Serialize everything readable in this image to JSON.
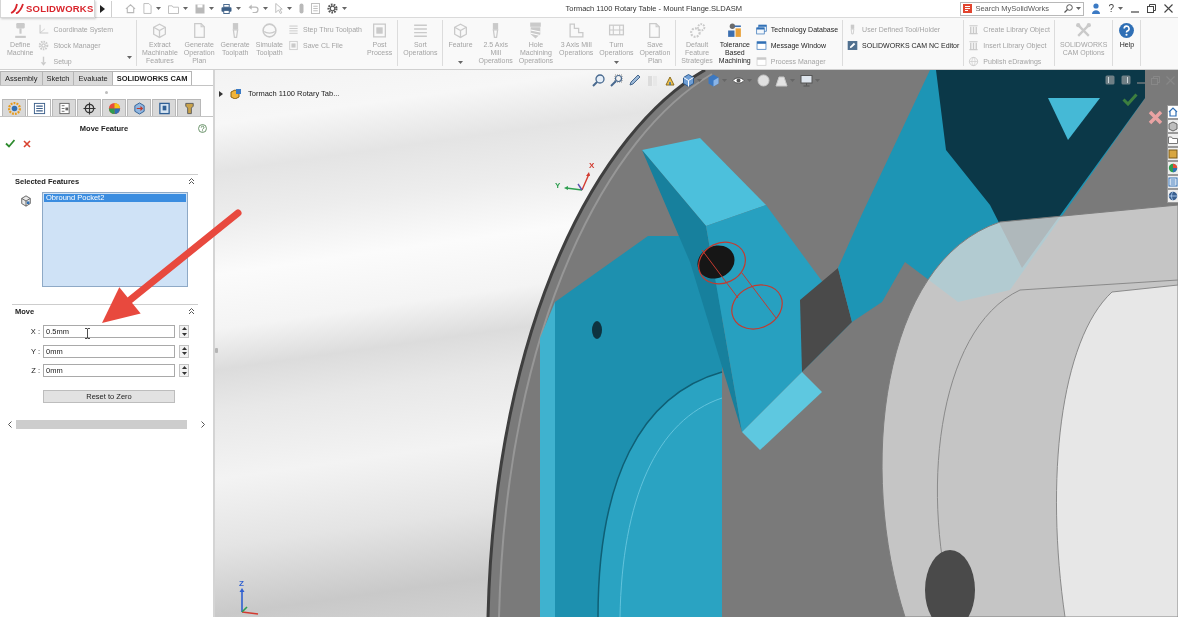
{
  "title_bar": {
    "logo": "SOLIDWORKS",
    "title": "Tormach 1100 Rotary Table - Mount Flange.SLDASM",
    "search": {
      "placeholder": "Search MySolidWorks"
    },
    "help_menu": "?"
  },
  "ribbon": {
    "groups": [
      {
        "items": [
          {
            "kind": "large",
            "label": "Define\nMachine",
            "disabled": true,
            "dropdown": false
          },
          {
            "kind": "stack",
            "dropdown": true,
            "entries": [
              {
                "label": "Coordinate System",
                "disabled": true
              },
              {
                "label": "Stock Manager",
                "disabled": true
              },
              {
                "label": "Setup",
                "disabled": true
              }
            ]
          }
        ]
      },
      {
        "items": [
          {
            "kind": "large",
            "label": "Extract\nMachinable\nFeatures",
            "disabled": true,
            "dropdown": false
          },
          {
            "kind": "large",
            "label": "Generate\nOperation\nPlan",
            "disabled": true,
            "dropdown": false
          },
          {
            "kind": "large",
            "label": "Generate\nToolpath",
            "disabled": true,
            "dropdown": false
          },
          {
            "kind": "large",
            "label": "Simulate\nToolpath",
            "disabled": true,
            "dropdown": false
          },
          {
            "kind": "stack",
            "dropdown": false,
            "entries": [
              {
                "label": "Step Thru Toolpath",
                "disabled": true
              },
              {
                "label": "Save CL File",
                "disabled": true
              }
            ]
          },
          {
            "kind": "large",
            "label": "Post\nProcess",
            "disabled": true,
            "dropdown": false
          }
        ]
      },
      {
        "items": [
          {
            "kind": "large",
            "label": "Sort\nOperations",
            "disabled": true,
            "dropdown": false
          }
        ]
      },
      {
        "items": [
          {
            "kind": "large",
            "label": "Feature",
            "disabled": true,
            "dropdown": true
          },
          {
            "kind": "large",
            "label": "2.5 Axis\nMill\nOperations",
            "disabled": true,
            "dropdown": false
          },
          {
            "kind": "large",
            "label": "Hole\nMachining\nOperations",
            "disabled": true,
            "dropdown": false
          },
          {
            "kind": "large",
            "label": "3 Axis Mill\nOperations",
            "disabled": true,
            "dropdown": false
          },
          {
            "kind": "large",
            "label": "Turn\nOperations",
            "disabled": true,
            "dropdown": true
          },
          {
            "kind": "large",
            "label": "Save\nOperation\nPlan",
            "disabled": true,
            "dropdown": false
          }
        ]
      },
      {
        "items": [
          {
            "kind": "large",
            "label": "Default\nFeature\nStrategies",
            "disabled": true,
            "dropdown": false
          },
          {
            "kind": "large",
            "label": "Tolerance\nBased\nMachining",
            "disabled": false,
            "dropdown": false
          },
          {
            "kind": "stack",
            "dropdown": false,
            "entries": [
              {
                "label": "Technology Database",
                "disabled": false
              },
              {
                "label": "Message Window",
                "disabled": false
              },
              {
                "label": "Process Manager",
                "disabled": true
              }
            ]
          }
        ]
      },
      {
        "items": [
          {
            "kind": "stack",
            "dropdown": false,
            "entries": [
              {
                "label": "User Defined Tool/Holder",
                "disabled": true
              },
              {
                "label": "SOLIDWORKS CAM NC Editor",
                "disabled": false
              }
            ]
          }
        ]
      },
      {
        "items": [
          {
            "kind": "stack",
            "dropdown": false,
            "entries": [
              {
                "label": "Create Library Object",
                "disabled": true
              },
              {
                "label": "Insert Library Object",
                "disabled": true
              },
              {
                "label": "Publish eDrawings",
                "disabled": true
              }
            ]
          }
        ]
      },
      {
        "items": [
          {
            "kind": "large",
            "label": "SOLIDWORKS\nCAM Options",
            "disabled": true,
            "dropdown": false
          }
        ]
      },
      {
        "items": [
          {
            "kind": "large",
            "label": "Help",
            "disabled": false,
            "dropdown": false
          }
        ]
      }
    ]
  },
  "command_tabs": [
    {
      "label": "Assembly",
      "selected": false
    },
    {
      "label": "Sketch",
      "selected": false
    },
    {
      "label": "Evaluate",
      "selected": false
    },
    {
      "label": "SOLIDWORKS CAM",
      "selected": true
    }
  ],
  "panel": {
    "tabs": [
      {
        "selected": false
      },
      {
        "selected": true
      },
      {
        "selected": false
      },
      {
        "selected": false
      },
      {
        "selected": false
      },
      {
        "selected": false
      },
      {
        "selected": false
      },
      {
        "selected": false
      }
    ],
    "title": "Move Feature",
    "sections": [
      {
        "kind": "list",
        "title": "Selected Features",
        "expanded": true,
        "items": [
          {
            "label": "Obround Pocket2",
            "selected": true
          }
        ]
      },
      {
        "kind": "move",
        "title": "Move",
        "expanded": true,
        "fields": [
          {
            "label": "X :",
            "value": "0.5mm"
          },
          {
            "label": "Y :",
            "value": "0mm"
          },
          {
            "label": "Z :",
            "value": "0mm"
          }
        ],
        "button": "Reset to Zero"
      }
    ]
  },
  "viewport": {
    "tree": {
      "label": "Tormach 1100 Rotary Tab...",
      "expanded": false
    },
    "triad_labels": [
      "Y",
      "X"
    ],
    "corner_triad_labels": [
      "Z"
    ]
  }
}
